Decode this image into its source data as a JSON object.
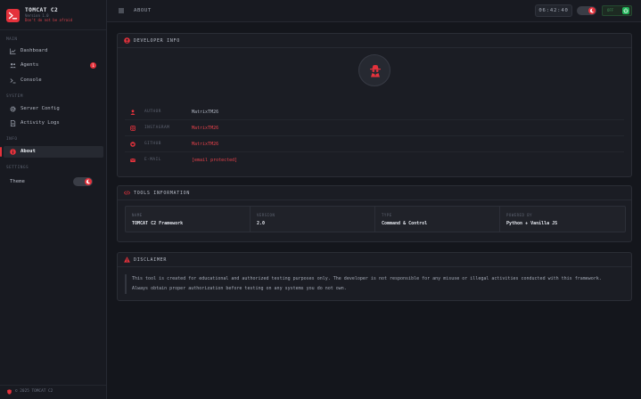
{
  "app": {
    "name": "TOMCAT C2",
    "version": "Version 1.0",
    "tagline": "Don't do not be afraid"
  },
  "sidebar": {
    "sections": {
      "main": "MAIN",
      "system": "SYSTEM",
      "info": "INFO",
      "settings": "SETTINGS"
    },
    "items": {
      "dashboard": "Dashboard",
      "agents": "Agents",
      "agents_badge": "1",
      "console": "Console",
      "server_config": "Server Config",
      "activity_logs": "Activity Logs",
      "about": "About"
    },
    "theme_label": "Theme",
    "footer": "© 2025 TOMCAT C2"
  },
  "topbar": {
    "page_title": "ABOUT",
    "clock": "06:42:40",
    "status": "OFF"
  },
  "developer": {
    "title": "DEVELOPER INFO",
    "rows": [
      {
        "key": "AUTHOR",
        "value": "MatrixTM26"
      },
      {
        "key": "INSTAGRAM",
        "value": "MatrixTM26"
      },
      {
        "key": "GITHUB",
        "value": "MatrixTM26"
      },
      {
        "key": "E-MAIL",
        "value": "[email protected]"
      }
    ]
  },
  "tools": {
    "title": "TOOLS INFORMATION",
    "cells": [
      {
        "key": "NAME",
        "value": "TOMCAT C2 Framework"
      },
      {
        "key": "VERSION",
        "value": "2.0"
      },
      {
        "key": "TYPE",
        "value": "Command & Control"
      },
      {
        "key": "POWERED BY",
        "value": "Python + Vanilla JS"
      }
    ]
  },
  "disclaimer": {
    "title": "DISCLAIMER",
    "line1": "This tool is created for educational and authorized testing purposes only. The developer is not responsible for any misuse or illegal activities conducted with this framework.",
    "line2": "Always obtain proper authorization before testing on any systems you do not own."
  },
  "colors": {
    "accent": "#e5323c",
    "background": "#14161c",
    "panel": "#1b1d24",
    "online": "#22b45a"
  },
  "icons": {
    "brand": "terminal-icon",
    "dashboard": "chart-line-icon",
    "agents": "users-icon",
    "console": "terminal-prompt-icon",
    "server_config": "gear-icon",
    "activity_logs": "document-icon",
    "about": "info-circle-icon",
    "avatar": "spy-icon"
  }
}
